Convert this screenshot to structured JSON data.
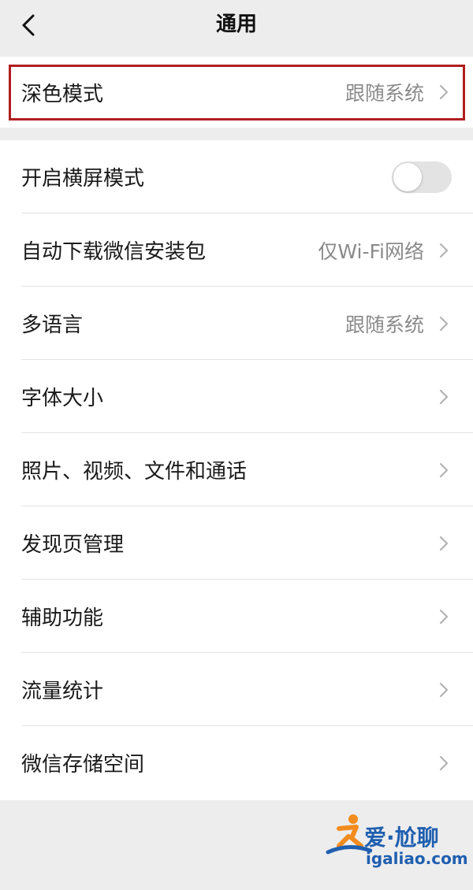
{
  "header": {
    "title": "通用",
    "back_icon": "chevron-left-icon"
  },
  "dark_mode": {
    "label": "深色模式",
    "value": "跟随系统",
    "highlight_color": "#b01e1e"
  },
  "settings": {
    "landscape": {
      "label": "开启横屏模式",
      "toggle_on": false
    },
    "auto_download": {
      "label": "自动下载微信安装包",
      "value": "仅Wi-Fi网络"
    },
    "language": {
      "label": "多语言",
      "value": "跟随系统"
    },
    "font_size": {
      "label": "字体大小"
    },
    "media": {
      "label": "照片、视频、文件和通话"
    },
    "discover": {
      "label": "发现页管理"
    },
    "accessibility": {
      "label": "辅助功能"
    },
    "traffic": {
      "label": "流量统计"
    },
    "storage": {
      "label": "微信存储空间"
    }
  },
  "watermark": {
    "brand": "爱·尬聊",
    "url": "igaliao.com",
    "color": "#1f5fb0"
  },
  "colors": {
    "background": "#ededed",
    "card": "#ffffff",
    "secondary_text": "#8a8a8a"
  }
}
